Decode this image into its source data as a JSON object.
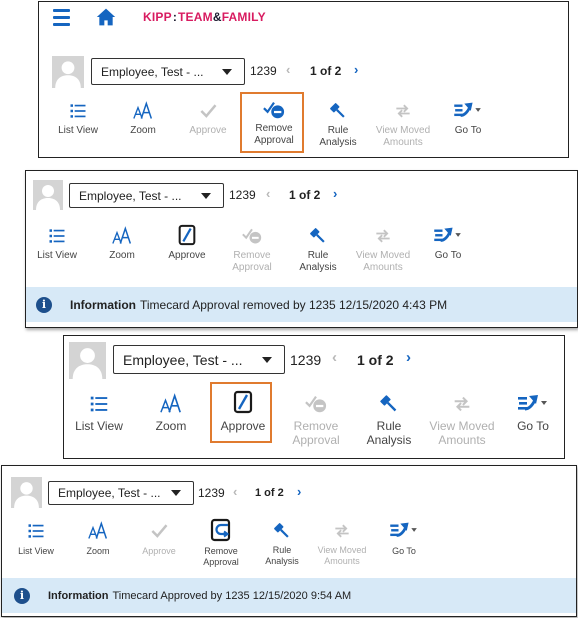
{
  "brand": {
    "part1": "KIPP",
    "part2": "TEAM",
    "part3": "&",
    "part4": "FAMILY"
  },
  "employee_select": {
    "selected": "Employee, Test - ..."
  },
  "employee_id": "1239",
  "pager": {
    "text": "1 of 2"
  },
  "toolbar": {
    "list_view": "List View",
    "zoom": "Zoom",
    "approve": "Approve",
    "remove_approval_1": "Remove",
    "remove_approval_2": "Approval",
    "rule_analysis_1": "Rule",
    "rule_analysis_2": "Analysis",
    "view_moved_1": "View Moved",
    "view_moved_2": "Amounts",
    "go_to": "Go To"
  },
  "messages": {
    "info_label": "Information",
    "removed": "Timecard Approval removed by 1235 12/15/2020 4:43 PM",
    "approved": "Timecard Approved by 1235 12/15/2020 9:54 AM"
  },
  "colors": {
    "accent": "#1565c0",
    "highlight": "#e07b2f",
    "info_bg": "#d7e9f7",
    "brand_pink": "#d81b60"
  },
  "panel_states": [
    {
      "panel": 1,
      "approve_enabled": false,
      "remove_approval_enabled": true,
      "highlighted": "remove_approval"
    },
    {
      "panel": 2,
      "approve_enabled": true,
      "remove_approval_enabled": false,
      "message": "removed"
    },
    {
      "panel": 3,
      "approve_enabled": true,
      "remove_approval_enabled": false,
      "highlighted": "approve"
    },
    {
      "panel": 4,
      "approve_enabled": false,
      "remove_approval_enabled": true,
      "message": "approved"
    }
  ]
}
